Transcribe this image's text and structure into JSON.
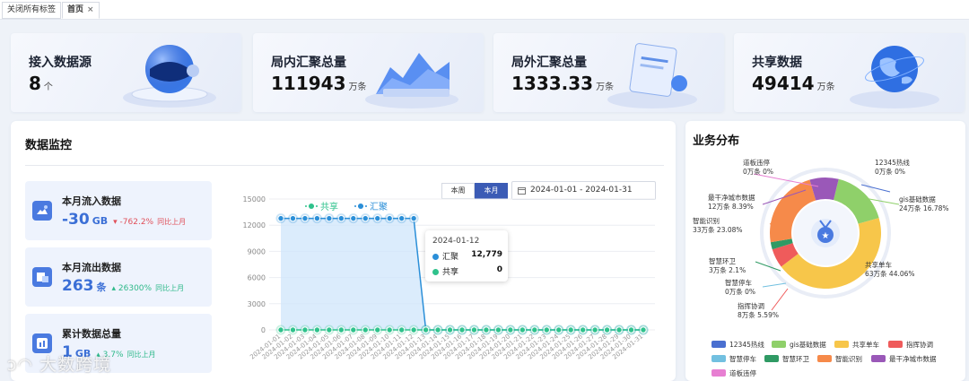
{
  "tabs": {
    "close_all": "关闭所有标签",
    "home": "首页",
    "close_icon": "×"
  },
  "stats": [
    {
      "title": "接入数据源",
      "value": "8",
      "unit": "个"
    },
    {
      "title": "局内汇聚总量",
      "value": "111943",
      "unit": "万条"
    },
    {
      "title": "局外汇聚总量",
      "value": "1333.33",
      "unit": "万条"
    },
    {
      "title": "共享数据",
      "value": "49414",
      "unit": "万条"
    }
  ],
  "monitor": {
    "title": "数据监控",
    "cards": [
      {
        "title": "本月流入数据",
        "value": "-30",
        "unit": "GB",
        "change": "-762.2%",
        "direction": "down",
        "compare": "同比上月"
      },
      {
        "title": "本月流出数据",
        "value": "263",
        "unit": "条",
        "change": "26300%",
        "direction": "up",
        "compare": "同比上月"
      },
      {
        "title": "累计数据总量",
        "value": "1",
        "unit": "GB",
        "change": "3.7%",
        "direction": "up",
        "compare": "同比上月"
      }
    ],
    "toggle": {
      "week": "本周",
      "month": "本月",
      "active": "month"
    },
    "date_range": "2024-01-01  -  2024-01-31",
    "tooltip": {
      "date": "2024-01-12",
      "rows": [
        {
          "name": "汇聚",
          "value": "12,779",
          "color": "#2b8fd8"
        },
        {
          "name": "共享",
          "value": "0",
          "color": "#2fc28c"
        }
      ]
    }
  },
  "chart_data": {
    "type": "line",
    "legend": [
      "共享",
      "汇聚"
    ],
    "y_ticks": [
      "15000",
      "12000",
      "9000",
      "6000",
      "3000",
      "0"
    ],
    "ylim": [
      0,
      15000
    ],
    "x": [
      "2024-01-01",
      "2024-01-02",
      "2024-01-03",
      "2024-01-04",
      "2024-01-05",
      "2024-01-06",
      "2024-01-07",
      "2024-01-08",
      "2024-01-09",
      "2024-01-10",
      "2024-01-11",
      "2024-01-12",
      "2024-01-13",
      "2024-01-14",
      "2024-01-15",
      "2024-01-16",
      "2024-01-17",
      "2024-01-18",
      "2024-01-19",
      "2024-01-20",
      "2024-01-21",
      "2024-01-22",
      "2024-01-23",
      "2024-01-24",
      "2024-01-25",
      "2024-01-26",
      "2024-01-27",
      "2024-01-28",
      "2024-01-29",
      "2024-01-30",
      "2024-01-31"
    ],
    "series": [
      {
        "name": "汇聚",
        "color": "#2b8fd8",
        "values": [
          12779,
          12779,
          12779,
          12779,
          12779,
          12779,
          12779,
          12779,
          12779,
          12779,
          12779,
          12779,
          0,
          0,
          0,
          0,
          0,
          0,
          0,
          0,
          0,
          0,
          0,
          0,
          0,
          0,
          0,
          0,
          0,
          0,
          0
        ]
      },
      {
        "name": "共享",
        "color": "#2fc28c",
        "values": [
          0,
          0,
          0,
          0,
          0,
          0,
          0,
          0,
          0,
          0,
          0,
          0,
          0,
          0,
          0,
          0,
          0,
          0,
          0,
          0,
          0,
          0,
          0,
          0,
          0,
          0,
          0,
          0,
          0,
          0,
          0
        ]
      }
    ]
  },
  "business": {
    "title": "业务分布",
    "slices": [
      {
        "name": "12345热线",
        "label": "0万条 0%",
        "value": 0,
        "color": "#4a6fd0"
      },
      {
        "name": "gis基础数据",
        "label": "24万条 16.78%",
        "value": 16.78,
        "color": "#8fd06a"
      },
      {
        "name": "共享单车",
        "label": "63万条 44.06%",
        "value": 44.06,
        "color": "#f7c64a"
      },
      {
        "name": "指挥协调",
        "label": "8万条 5.59%",
        "value": 5.59,
        "color": "#ef5b5b"
      },
      {
        "name": "智慧停车",
        "label": "0万条 0%",
        "value": 0,
        "color": "#72c0e0"
      },
      {
        "name": "智慧环卫",
        "label": "3万条 2.1%",
        "value": 2.1,
        "color": "#2f9a64"
      },
      {
        "name": "智能识别",
        "label": "33万条 23.08%",
        "value": 23.08,
        "color": "#f68a4a"
      },
      {
        "name": "最干净城市数据",
        "label": "12万条 8.39%",
        "value": 8.39,
        "color": "#9a58b8"
      },
      {
        "name": "道板违停",
        "label": "0万条 0%",
        "value": 0,
        "color": "#e77fd2"
      }
    ]
  },
  "watermark": "大数跨境"
}
